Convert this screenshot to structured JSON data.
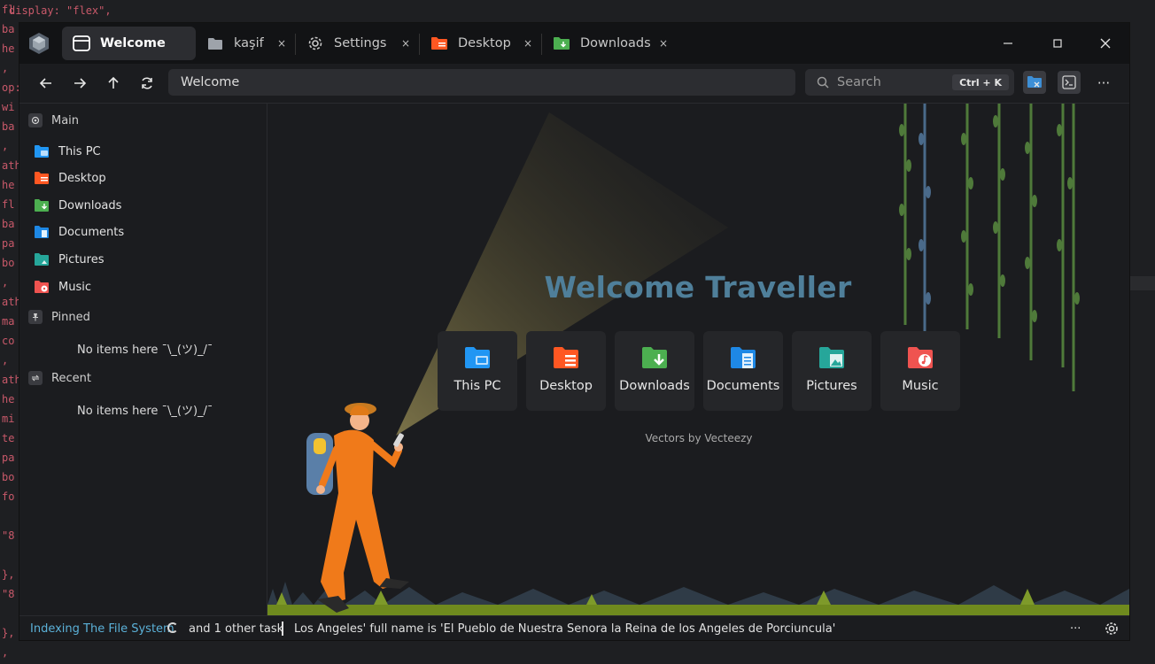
{
  "background": {
    "code_top": "display: \"flex\",",
    "code_lines": [
      "fl",
      "ba",
      "he",
      ",",
      "op:",
      "wi",
      "ba",
      ",",
      "ath",
      "he",
      "fl",
      "ba",
      "pa",
      "bo",
      ",",
      "ath",
      "ma",
      "co",
      ",",
      "ath",
      "he",
      "mi",
      "te",
      "pa",
      "bo",
      "fo",
      "",
      "\"8",
      "",
      "},",
      "\"8",
      "",
      "},",
      ",",
      ";"
    ]
  },
  "tabs": [
    {
      "label": "Welcome",
      "icon": "window-icon"
    },
    {
      "label": "kaşif",
      "icon": "folder-icon"
    },
    {
      "label": "Settings",
      "icon": "gear-icon"
    },
    {
      "label": "Desktop",
      "icon": "desktop-folder-icon"
    },
    {
      "label": "Downloads",
      "icon": "downloads-folder-icon"
    }
  ],
  "tab_close": "×",
  "window_controls": {
    "minimize": "—",
    "maximize": "☐",
    "close": "✕"
  },
  "address": {
    "value": "Welcome"
  },
  "search": {
    "placeholder": "Search",
    "shortcut": "Ctrl + K"
  },
  "more_glyph": "···",
  "sidebar": {
    "main_label": "Main",
    "items": [
      {
        "label": "This PC",
        "color": "#2196f3"
      },
      {
        "label": "Desktop",
        "color": "#ff5722"
      },
      {
        "label": "Downloads",
        "color": "#4caf50"
      },
      {
        "label": "Documents",
        "color": "#1e88e5"
      },
      {
        "label": "Pictures",
        "color": "#26a69a"
      },
      {
        "label": "Music",
        "color": "#ef5350"
      }
    ],
    "pinned_label": "Pinned",
    "pinned_empty": "No items here ¯\\_(ツ)_/¯",
    "recent_label": "Recent",
    "recent_empty": "No items here ¯\\_(ツ)_/¯"
  },
  "welcome": {
    "title": "Welcome Traveller",
    "tiles": [
      {
        "label": "This PC",
        "color": "#2196f3"
      },
      {
        "label": "Desktop",
        "color": "#ff5722"
      },
      {
        "label": "Downloads",
        "color": "#4caf50"
      },
      {
        "label": "Documents",
        "color": "#1e88e5"
      },
      {
        "label": "Pictures",
        "color": "#26a69a"
      },
      {
        "label": "Music",
        "color": "#ef5350"
      }
    ],
    "credit": "Vectors by Vecteezy"
  },
  "status": {
    "indexing": "Indexing The File System",
    "other_tasks": "and 1 other task",
    "fact": "Los Angeles' full name is 'El Pueblo de Nuestra Senora la Reina de los Angeles de Porciuncula'",
    "more": "···"
  },
  "colors": {
    "accent": "#5bb1d8",
    "title": "#4f7f9a",
    "brand": "#4a6a8a"
  }
}
